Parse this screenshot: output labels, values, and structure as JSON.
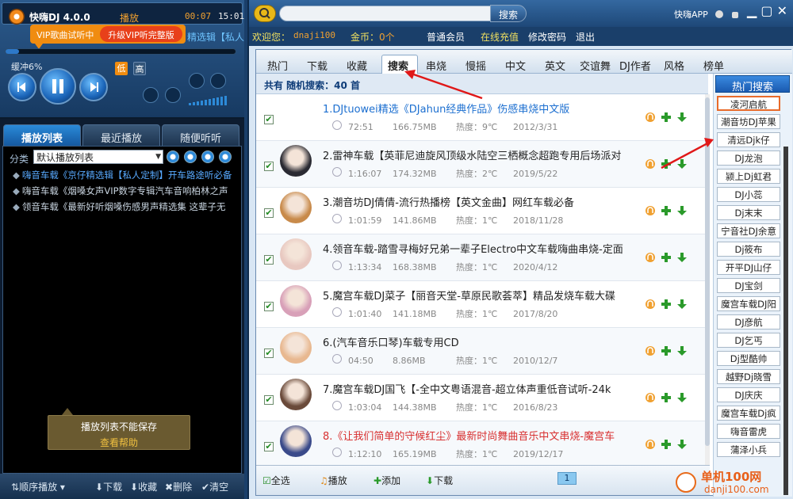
{
  "player": {
    "app_name": "快嗨DJ 4.0.0",
    "state": "播放",
    "time_elapsed": "00:07",
    "time_total": "15:01",
    "vip_tip": "VIP歌曲试听中",
    "vip_upgrade": "升级VIP听完整版",
    "marquee": "精选辑【私人",
    "buffer": "缓冲6%",
    "progress": 0.06,
    "mode_low": "低",
    "mode_high": "高"
  },
  "list_tabs": [
    "播放列表",
    "最近播放",
    "随便听听"
  ],
  "playlist": {
    "cat_label": "分类",
    "cat_value": "默认播放列表",
    "tracks": [
      "嗨音车载《京仔精选辑【私人定制】开车路途听必备",
      "嗨音车载《烟嗓女声VIP数字专辑汽车音响柏林之声",
      "领音车载《最新好听烟嗓伤感男声精选集 这辈子无"
    ],
    "save_tip": "播放列表不能保存",
    "save_help": "查看帮助"
  },
  "left_bottom": [
    "顺序播放",
    "下载",
    "收藏",
    "删除",
    "清空"
  ],
  "topbar": {
    "search_btn": "搜索",
    "app_label": "快嗨APP"
  },
  "userbar": {
    "welcome": "欢迎您：",
    "username": "dnaji100",
    "coins_label": "金币：",
    "coins": "0个",
    "member": "普通会员",
    "recharge": "在线充值",
    "change_pwd": "修改密码",
    "logout": "退出"
  },
  "categories": [
    "热门",
    "下载",
    "收藏",
    "搜索",
    "串烧",
    "慢摇",
    "中文",
    "英文",
    "交谊舞",
    "DJ作者",
    "风格",
    "榜单"
  ],
  "result": {
    "label": "共有 随机搜索：40 首"
  },
  "songs": [
    {
      "title": "1.DJtuowei精选《DJahun经典作品》伤感串烧中文版",
      "duration": "72:51",
      "size": "166.75MB",
      "heat": "热度：9℃",
      "date": "2012/3/31",
      "style": "link",
      "cover": ""
    },
    {
      "title": "2.雷神车载【英菲尼迪旋风顶级水陆空三栖概念超跑专用后场派对",
      "duration": "1:16:07",
      "size": "174.32MB",
      "heat": "热度：2℃",
      "date": "2019/5/22",
      "style": "",
      "cover": "#2a2a32"
    },
    {
      "title": "3.潮音坊DJ倩倩-流行热播榜【英文金曲】网红车载必备",
      "duration": "1:01:59",
      "size": "141.86MB",
      "heat": "热度：1℃",
      "date": "2018/11/28",
      "style": "",
      "cover": "#c88a4a"
    },
    {
      "title": "4.领音车载-踏雪寻梅好兄弟一辈子Electro中文车载嗨曲串烧-定面",
      "duration": "1:13:34",
      "size": "168.38MB",
      "heat": "热度：1℃",
      "date": "2020/4/12",
      "style": "",
      "cover": "#e8c8c0"
    },
    {
      "title": "5.魔宫车载DJ菜子【丽音天堂-草原民歌荟萃】精品发烧车载大碟",
      "duration": "1:01:40",
      "size": "141.18MB",
      "heat": "热度：1℃",
      "date": "2017/8/20",
      "style": "",
      "cover": "#d8a0b8"
    },
    {
      "title": "6.(汽车音乐口琴)车载专用CD",
      "duration": "04:50",
      "size": "8.86MB",
      "heat": "热度：1℃",
      "date": "2010/12/7",
      "style": "",
      "cover": "#e8b890"
    },
    {
      "title": "7.魔宫车载DJ国飞【-全中文粤语混音-超立体声重低音试听-24k",
      "duration": "1:03:04",
      "size": "144.38MB",
      "heat": "热度：1℃",
      "date": "2016/8/23",
      "style": "",
      "cover": "#6a4a3a"
    },
    {
      "title": "8.《让我们简单的守候红尘》最新时尚舞曲音乐中文串烧-魔宫车",
      "duration": "1:12:10",
      "size": "165.19MB",
      "heat": "热度：1℃",
      "date": "2019/12/17",
      "style": "red",
      "cover": "#3a4a8a"
    }
  ],
  "bottom": {
    "select_all": "全选",
    "play": "播放",
    "add": "添加",
    "download": "下载",
    "page": "1"
  },
  "hot": {
    "title": "热门搜索",
    "items": [
      "凌河启航",
      "潮音坊DJ苹果",
      "清远Djk仔",
      "DJ龙泡",
      "颍上Dj虹君",
      "DJ小蕊",
      "Dj末末",
      "宁音社DJ余意",
      "Dj筱布",
      "开平DJ山仔",
      "DJ宝剑",
      "魔宫车载DJ阳",
      "DJ彦航",
      "DJ乞丐",
      "Dj型酷帅",
      "越野Dj晓雪",
      "DJ庆庆",
      "魔宫车载Dj疯",
      "嗨音雷虎",
      "蒲泽小兵"
    ]
  },
  "watermark": {
    "cn": "单机100网",
    "url": "danji100.com"
  }
}
